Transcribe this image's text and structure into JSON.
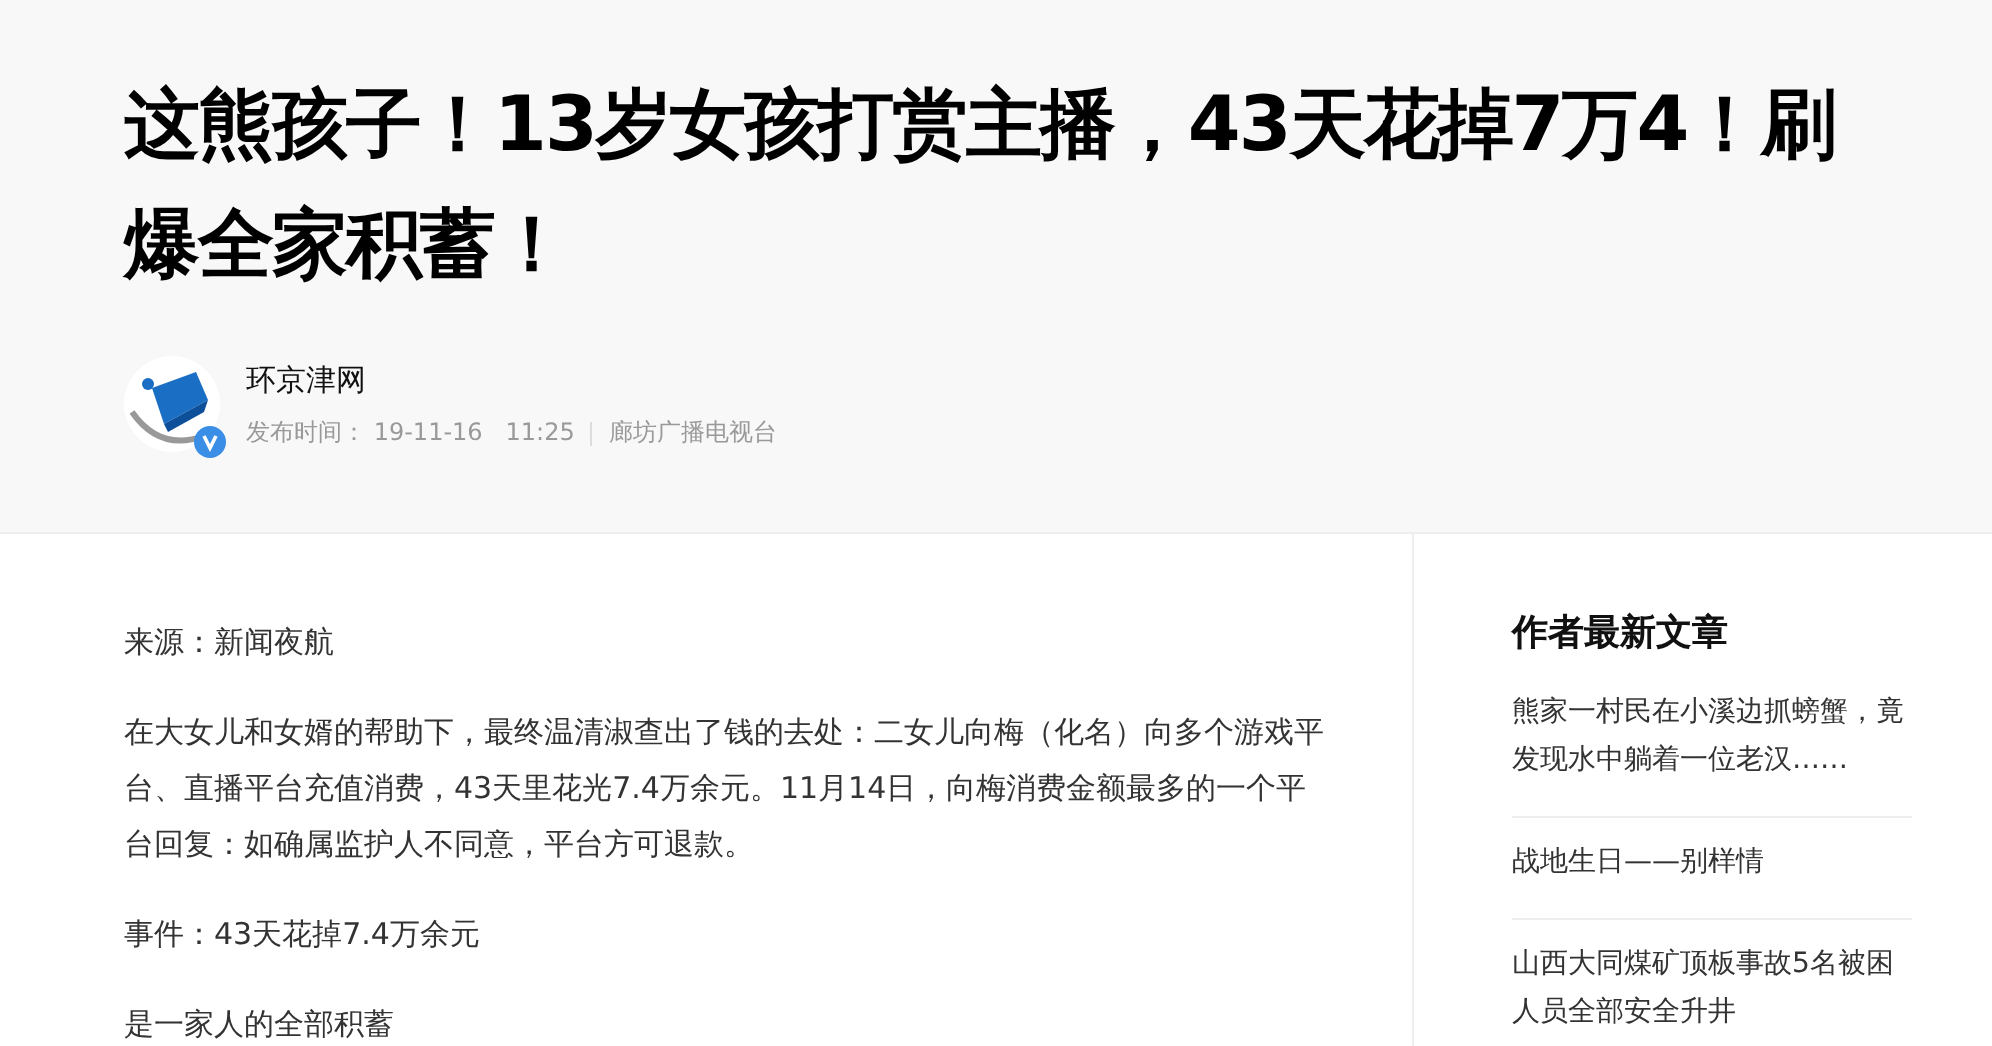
{
  "article": {
    "title": "这熊孩子！13岁女孩打赏主播，43天花掉7万4！刷爆全家积蓄！",
    "author": {
      "name": "环京津网",
      "verified": true,
      "publish_label": "发布时间：",
      "date": "19-11-16",
      "time": "11:25",
      "source": "廊坊广播电视台"
    },
    "paragraphs": [
      "来源：新闻夜航",
      "在大女儿和女婿的帮助下，最终温清淑查出了钱的去处：二女儿向梅（化名）向多个游戏平台、直播平台充值消费，43天里花光7.4万余元。11月14日，向梅消费金额最多的一个平台回复：如确属监护人不同意，平台方可退款。",
      "事件：43天花掉7.4万余元",
      "是一家人的全部积蓄"
    ]
  },
  "sidebar": {
    "title": "作者最新文章",
    "items": [
      "熊家一村民在小溪边抓螃蟹，竟发现水中躺着一位老汉……",
      "战地生日——别样情",
      "山西大同煤矿顶板事故5名被困人员全部安全升井"
    ]
  }
}
